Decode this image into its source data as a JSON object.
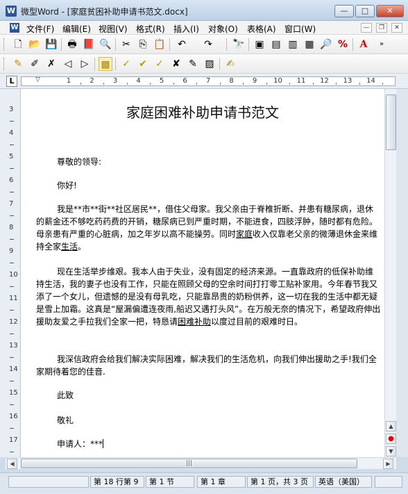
{
  "window": {
    "app_icon": "W",
    "title": "微型Word - [家庭贫困补助申请书范文.docx]",
    "min": "—",
    "max": "□",
    "close": "✕"
  },
  "menu": {
    "icon": "W",
    "items": [
      "文件(F)",
      "编辑(E)",
      "视图(V)",
      "格式(R)",
      "插入(I)",
      "对象(O)",
      "表格(A)",
      "窗口(W)"
    ],
    "mdi": [
      "—",
      "❐",
      "✕"
    ]
  },
  "toolbar1": [
    {
      "icon": "new-icon",
      "glyph": "🗋"
    },
    {
      "icon": "open-icon",
      "glyph": "📂"
    },
    {
      "icon": "save-icon",
      "glyph": "💾"
    },
    {
      "icon": "print-icon",
      "glyph": "🖶"
    },
    {
      "icon": "pdf-icon",
      "glyph": "📕"
    },
    {
      "icon": "print-preview-icon",
      "glyph": "🔍"
    },
    {
      "icon": "cut-icon",
      "glyph": "✂"
    },
    {
      "icon": "copy-icon",
      "glyph": "⎘"
    },
    {
      "icon": "paste-icon",
      "glyph": "📋"
    },
    {
      "icon": "undo-icon",
      "glyph": "↶"
    },
    {
      "icon": "redo-icon",
      "glyph": "↷"
    },
    {
      "icon": "find-icon",
      "glyph": "🔭"
    },
    {
      "icon": "page-number-icon",
      "glyph": "▣"
    },
    {
      "icon": "field-icon",
      "glyph": "▤"
    },
    {
      "icon": "page-view-icon",
      "glyph": "▥"
    },
    {
      "icon": "outline-view-icon",
      "glyph": "▦"
    },
    {
      "icon": "zoom-icon",
      "glyph": "🔎"
    },
    {
      "icon": "spell-check-icon",
      "glyph": "%"
    },
    {
      "icon": "font-color-icon",
      "glyph": "A"
    }
  ],
  "toolbar2": [
    {
      "icon": "track-changes-icon",
      "glyph": "✎"
    },
    {
      "icon": "edit-comment-icon",
      "glyph": "✐"
    },
    {
      "icon": "delete-comment-icon",
      "glyph": "✗"
    },
    {
      "icon": "previous-comment-icon",
      "glyph": "◁"
    },
    {
      "icon": "next-comment-icon",
      "glyph": "▷"
    },
    {
      "icon": "review-pane-icon",
      "glyph": "▩"
    },
    {
      "icon": "accept-change-icon",
      "glyph": "✓"
    },
    {
      "icon": "reject-change-icon",
      "glyph": "✔"
    },
    {
      "icon": "accept-all-icon",
      "glyph": "✓"
    },
    {
      "icon": "reject-all-icon",
      "glyph": "✘"
    },
    {
      "icon": "show-markup-icon",
      "glyph": "✎"
    },
    {
      "icon": "reviewing-toolbar-icon",
      "glyph": "▨"
    },
    {
      "icon": "highlight-icon",
      "glyph": "✍"
    }
  ],
  "ruler": {
    "corner": "L",
    "numbers": [
      "1",
      "2",
      "3",
      "4",
      "5",
      "6",
      "7",
      "8",
      "9",
      "10",
      "11",
      "12",
      "13",
      "14"
    ]
  },
  "vruler": {
    "numbers": [
      "3",
      "4",
      "5",
      "6",
      "7",
      "8",
      "9",
      "10",
      "11",
      "12",
      "13",
      "14",
      "15",
      "16",
      "17"
    ]
  },
  "document": {
    "title": "家庭困难补助申请书范文",
    "salutation": "尊敬的领导:",
    "greeting": "你好!",
    "p1_a": "我是**市**街**社区居民**，借住父母家。我父亲由于脊椎折断、并患有糖尿病，退休的薪金还不够吃药药费的开销，糖尿病已到严重时期，不能进食，四肢浮肿，随时都有危险。母亲患有严重的心脏病，加之年岁以高不能操劳。同时",
    "p1_u1": "家庭",
    "p1_b": "收入仅靠老父亲的微薄退休金来维持全家",
    "p1_u2": "生活",
    "p1_c": "。",
    "p2_a": "现在生活举步维艰。我本人由于失业，没有固定的经济来源。一直靠政府的低保补助维持生活，我的妻子也没有工作，只能在照顾父母的空余时间打打零工贴补家用。今年春节我又添了一个女儿，但遗憾的是没有母乳吃，只能靠昂贵的奶粉供养，这一切在我的生活中都无疑是雪上加霜。这真是“屋漏偏遭连夜雨,船迟又遇打头风”。在万般无奈的情况下，希望政府伸出援助友爱之手拉我们全家一把，特恳请",
    "p2_u": "困难补助",
    "p2_b": "以度过目前的艰难时日。",
    "p3": "我深信政府会给我们解决实际困难，解决我们的生活危机，向我们伸出援助之手!我们全家期待着您的佳音.",
    "closing1": "此致",
    "closing2": "敬礼",
    "signature": "申请人：***"
  },
  "status": {
    "row_col": "第 18 行第 9",
    "section": "第 1 节",
    "chapter": "第 1 章",
    "page": "第 1 页，共 3 页",
    "language": "英语（美国）"
  }
}
